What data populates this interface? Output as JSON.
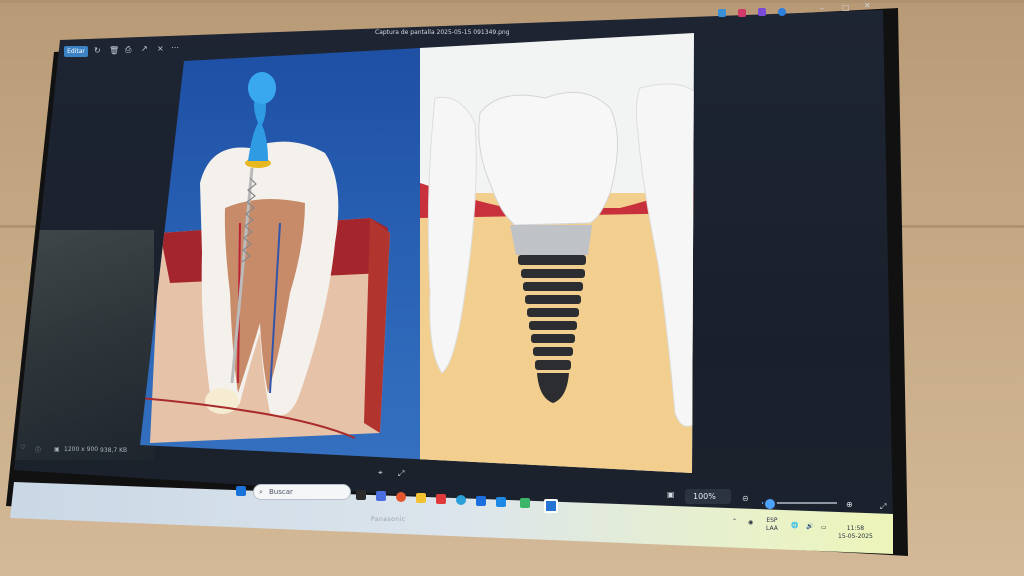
{
  "window": {
    "title": "Captura de pantalla 2025-05-15 091349.png",
    "edit_label": "Editar"
  },
  "status": {
    "dimensions": "1200 x 900",
    "filesize": "938,7 KB"
  },
  "controls": {
    "zoom": "100%",
    "zoom_level": 0.1
  },
  "taskbar": {
    "search_placeholder": "Buscar",
    "lang_top": "ESP",
    "lang_bottom": "LAA",
    "time": "11:58",
    "date": "15-05-2025"
  },
  "monitor": {
    "brand": "Panasonic"
  },
  "colors": {
    "accent": "#3b82c4",
    "slider": "#4da3ff",
    "left_panel_bg": "#1d4ea3"
  }
}
